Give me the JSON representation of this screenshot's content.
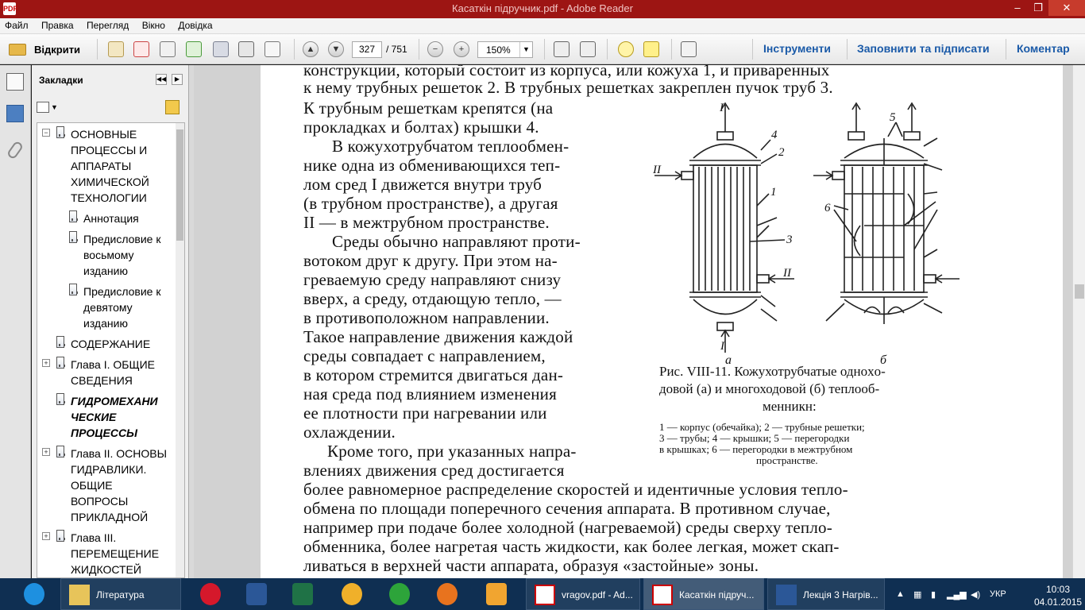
{
  "window": {
    "title": "Касаткін підручник.pdf - Adobe Reader",
    "minimize": "–",
    "maximize": "❐",
    "close": "✕",
    "app_icon_text": "PDF"
  },
  "menu": [
    "Файл",
    "Правка",
    "Перегляд",
    "Вікно",
    "Довідка"
  ],
  "toolbar": {
    "open_label": "Відкрити",
    "page_current": "327",
    "page_total": "/ 751",
    "zoom": "150%",
    "tools": "Інструменти",
    "fill_sign": "Заповнити та підписати",
    "comment": "Коментар"
  },
  "bookmarks": {
    "title": "Закладки",
    "items": [
      {
        "label": "ОСНОВНЫЕ ПРОЦЕССЫ И АППАРАТЫ ХИМИЧЕСКОЙ ТЕХНОЛОГИИ",
        "lines": [
          "ОСНОВНЫЕ",
          "ПРОЦЕССЫ И",
          "АППАРАТЫ",
          "ХИМИЧЕСКОЙ",
          "ТЕХНОЛОГИИ"
        ],
        "expander": "−"
      },
      {
        "label": "Аннотация",
        "lines": [
          "Аннотация"
        ]
      },
      {
        "label": "Предисловие к восьмому изданию",
        "lines": [
          "Предисловие к",
          "восьмому",
          "изданию"
        ]
      },
      {
        "label": "Предисловие к девятому изданию",
        "lines": [
          "Предисловие к",
          "девятому",
          "изданию"
        ]
      },
      {
        "label": "СОДЕРЖАНИЕ",
        "lines": [
          "СОДЕРЖАНИЕ"
        ]
      },
      {
        "label": "Глава I. ОБЩИЕ СВЕДЕНИЯ",
        "lines": [
          "Глава I. ОБЩИЕ",
          "СВЕДЕНИЯ"
        ],
        "expander": "+"
      },
      {
        "label": "ГИДРОМЕХАНИЧЕСКИЕ ПРОЦЕССЫ",
        "lines": [
          "ГИДРОМЕХАНИ",
          "ЧЕСКИЕ",
          "ПРОЦЕССЫ"
        ],
        "selected": true
      },
      {
        "label": "Глава II. ОСНОВЫ ГИДРАВЛИКИ. ОБЩИЕ ВОПРОСЫ ПРИКЛАДНОЙ",
        "lines": [
          "Глава II. ОСНОВЫ",
          "ГИДРАВЛИКИ.",
          "ОБЩИЕ",
          "ВОПРОСЫ",
          "ПРИКЛАДНОЙ"
        ],
        "expander": "+"
      },
      {
        "label": "Глава III. ПЕРЕМЕЩЕНИЕ ЖИДКОСТЕЙ",
        "lines": [
          "Глава III.",
          "ПЕРЕМЕЩЕНИЕ",
          "ЖИДКОСТЕЙ"
        ],
        "expander": "+"
      }
    ]
  },
  "document": {
    "lines_full_top": [
      "конструкции, который состоит из корпуса, или кожуха 1, и приваренных",
      "к нему трубных решеток 2. В трубных решетках закреплен пучок труб 3."
    ],
    "lines_left": [
      "К трубным решеткам крепятся (на",
      "прокладках и болтах) крышки 4.",
      "В кожухотрубчатом теплообмен-",
      "нике одна из обменивающихся теп-",
      "лом сред I движется внутри труб",
      "(в трубном пространстве), а другая",
      "II — в межтрубном пространстве.",
      "Среды обычно направляют проти-",
      "вотоком друг к другу. При этом на-",
      "греваемую среду направляют снизу",
      "вверх, а среду, отдающую тепло, —",
      "в противоположном направлении.",
      "Такое направление движения каждой",
      "среды совпадает с направлением,",
      "в котором стремится двигаться дан-",
      "ная среда под влиянием изменения",
      "ее плотности при нагревании или",
      "охлаждении.",
      "Кроме того, при указанных напра-",
      "влениях движения сред достигается"
    ],
    "lines_full_bottom": [
      "более равномерное распределение скоростей и идентичные условия тепло-",
      "обмена по площади поперечного сечения аппарата. В противном случае,",
      "например при подаче более холодной (нагреваемой) среды сверху тепло-",
      "обменника, более нагретая часть жидкости, как более легкая, может скап-",
      "ливаться в верхней части аппарата, образуя «застойные» зоны."
    ],
    "figure_caption": [
      "Рис. VIII-11. Кожухотрубчатые одноxо-",
      "довой (а) и многоходовой (б) теплооб-",
      "менникн:"
    ],
    "figure_legend": [
      "1 — корпус (обечайка); 2 — трубные решетки;",
      "3 — трубы;   4 — крышки;   5 — перегородки",
      "в крышках;  6 — перегородки  в межтрубном",
      "пространстве."
    ],
    "figure_sub_a": "а",
    "figure_sub_b": "б",
    "figure_labels": {
      "I_top": "I",
      "I_bottom": "I",
      "II_left": "II",
      "II_right": "II",
      "n1": "1",
      "n2": "2",
      "n3": "3",
      "n4": "4",
      "n5": "5",
      "n6": "6"
    }
  },
  "taskbar": {
    "windows": [
      {
        "label": "Література"
      },
      {
        "label": "vragov.pdf - Ad..."
      },
      {
        "label": "Касаткін підруч..."
      },
      {
        "label": "Лекція 3 Нагрів..."
      }
    ],
    "lang": "УКР",
    "time": "10:03",
    "date": "04.01.2015"
  }
}
